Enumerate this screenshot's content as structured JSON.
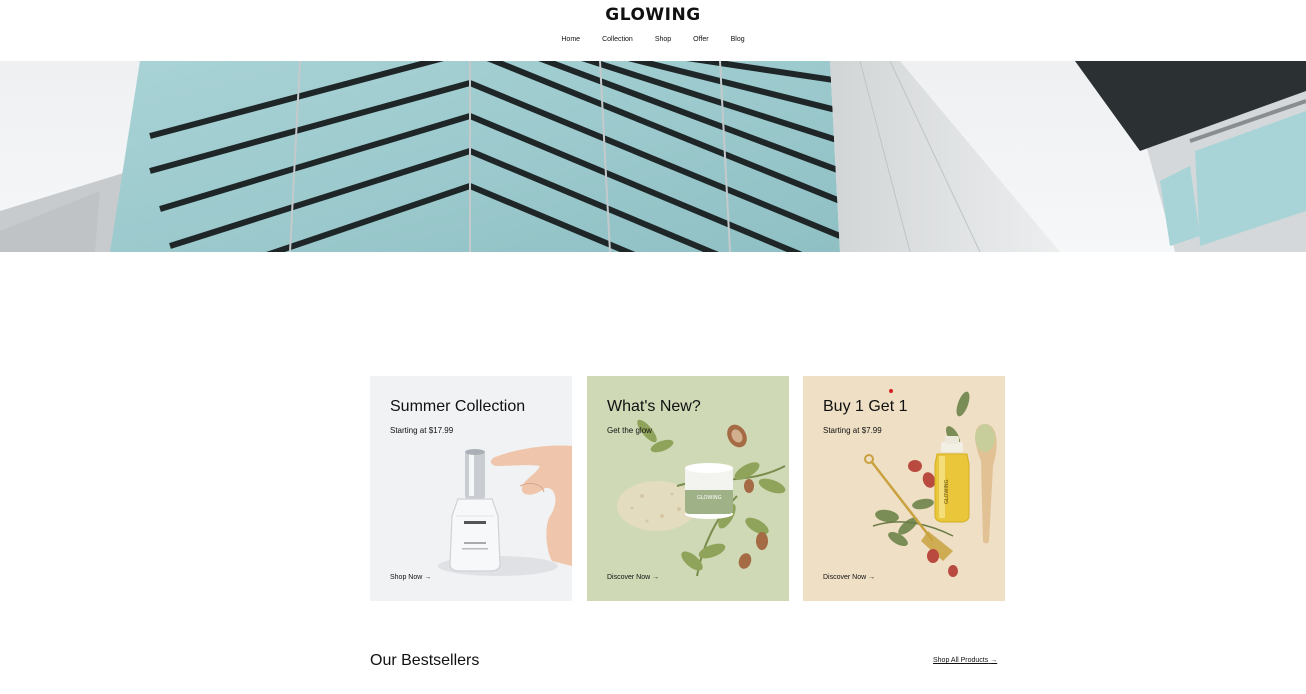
{
  "brand": {
    "name": "GLOWING"
  },
  "nav": {
    "items": [
      {
        "label": "Home"
      },
      {
        "label": "Collection"
      },
      {
        "label": "Shop"
      },
      {
        "label": "Offer"
      },
      {
        "label": "Blog"
      }
    ]
  },
  "hero": {
    "image": "building-glass-facade"
  },
  "cards": [
    {
      "title": "Summer Collection",
      "subtitle": "Starting at $17.99",
      "cta": "Shop Now",
      "bg": "#f1f2f4"
    },
    {
      "title": "What's New?",
      "subtitle": "Get the glow",
      "cta": "Discover Now",
      "bg": "#cfd9b6"
    },
    {
      "title": "Buy 1 Get 1",
      "subtitle": "Starting at $7.99",
      "cta": "Discover Now",
      "bg": "#eedfc5"
    }
  ],
  "bestsellers": {
    "title": "Our Bestsellers",
    "link": "Shop All Products"
  },
  "icons": {
    "arrow": "arrow-right-icon"
  },
  "colors": {
    "text": "#111111",
    "accent_dot": "#d82020"
  }
}
